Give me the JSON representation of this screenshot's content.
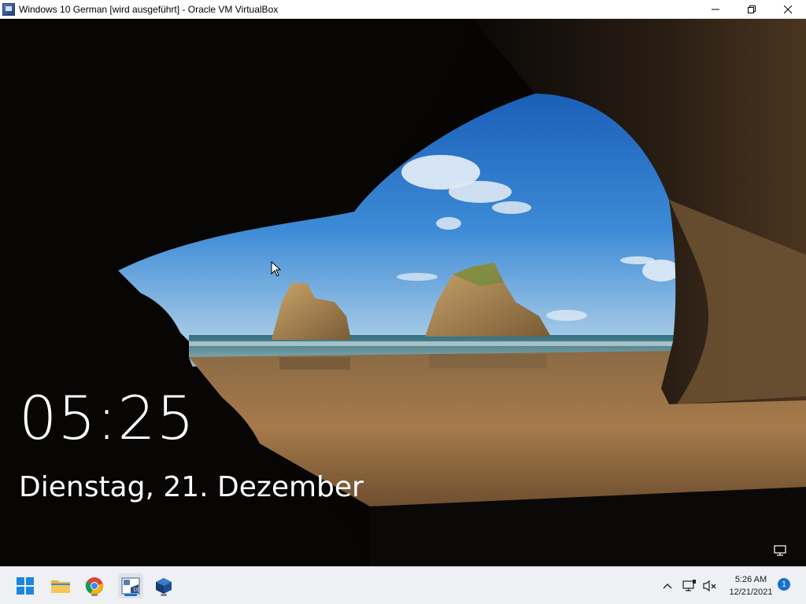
{
  "window": {
    "title": "Windows 10 German [wird ausgeführt] - Oracle VM VirtualBox",
    "icon": "virtualbox-vm-icon",
    "controls": [
      "minimize-icon",
      "restore-icon",
      "close-icon"
    ]
  },
  "lockscreen": {
    "time": "05:25",
    "date": "Dienstag, 21. Dezember",
    "network_icon": "network-icon"
  },
  "taskbar": {
    "icons": [
      "start-icon",
      "file-explorer-icon",
      "chrome-icon",
      "windows10-vm-icon",
      "virtualbox-icon"
    ],
    "tray": {
      "chevron": "chevron-up-icon",
      "network": "network-icon",
      "volume": "volume-muted-icon",
      "time": "5:26 AM",
      "date": "12/21/2021",
      "notifications_count": "1"
    },
    "accent": "#1a6fd6"
  }
}
